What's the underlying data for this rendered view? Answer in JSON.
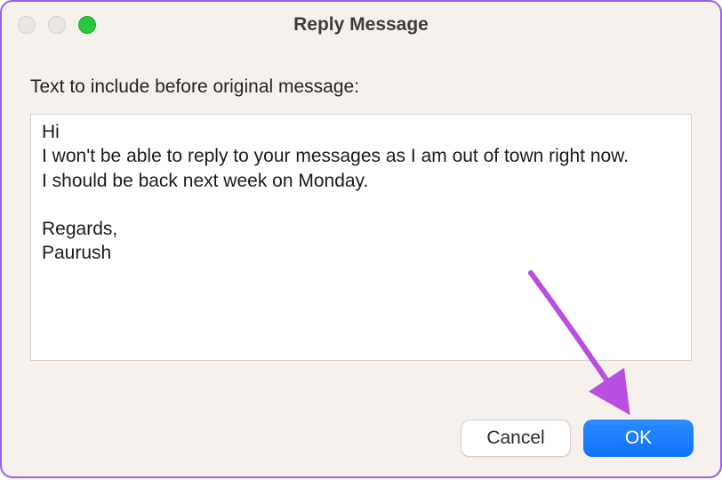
{
  "window": {
    "title": "Reply Message"
  },
  "form": {
    "label": "Text to include before original message:",
    "message": "Hi\nI won't be able to reply to your messages as I am out of town right now.\nI should be back next week on Monday.\n\nRegards,\nPaurush"
  },
  "buttons": {
    "cancel": "Cancel",
    "ok": "OK"
  },
  "annotation": {
    "arrow_color": "#b84fe0"
  }
}
